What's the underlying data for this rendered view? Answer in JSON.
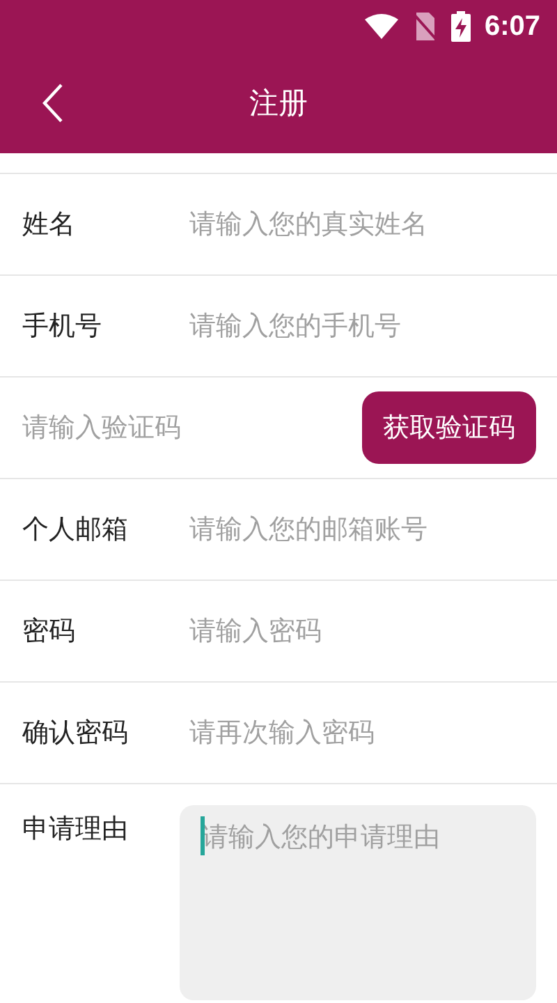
{
  "status_bar": {
    "time": "6:07"
  },
  "app_bar": {
    "title": "注册"
  },
  "form": {
    "rows": [
      {
        "kind": "field",
        "label": "姓名",
        "placeholder": "请输入您的真实姓名"
      },
      {
        "kind": "field",
        "label": "手机号",
        "placeholder": "请输入您的手机号"
      },
      {
        "kind": "code",
        "placeholder": "请输入验证码",
        "button": "获取验证码"
      },
      {
        "kind": "field",
        "label": "个人邮箱",
        "placeholder": "请输入您的邮箱账号"
      },
      {
        "kind": "field",
        "label": "密码",
        "placeholder": "请输入密码"
      },
      {
        "kind": "field",
        "label": "确认密码",
        "placeholder": "请再次输入密码"
      },
      {
        "kind": "textarea",
        "label": "申请理由",
        "placeholder": "请输入您的申请理由",
        "focused": true
      }
    ]
  }
}
